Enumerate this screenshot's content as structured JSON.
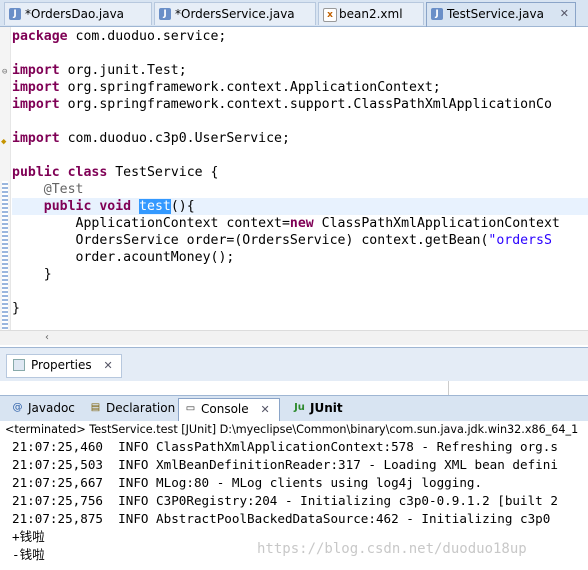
{
  "editor_tabs": [
    {
      "label": "*OrdersDao.java",
      "icon": "java-file-icon"
    },
    {
      "label": "*OrdersService.java",
      "icon": "java-file-icon"
    },
    {
      "label": "bean2.xml",
      "icon": "xml-file-icon"
    },
    {
      "label": "TestService.java",
      "icon": "java-file-icon",
      "active": true
    }
  ],
  "code": {
    "line1": {
      "kw": "package",
      "rest": " com.duoduo.service;"
    },
    "line3": {
      "kw": "import",
      "rest": " org.junit.Test;"
    },
    "line4": {
      "kw": "import",
      "rest": " org.springframework.context.ApplicationContext;"
    },
    "line5": {
      "kw": "import",
      "rest": " org.springframework.context.support.ClassPathXmlApplicationCo"
    },
    "line7": {
      "kw": "import",
      "rest": " com.duoduo.c3p0.UserService;"
    },
    "line9": {
      "kw1": "public",
      "kw2": "class",
      "rest": " TestService {"
    },
    "line10": {
      "ann": "@Test"
    },
    "line11": {
      "kw1": "public",
      "kw2": "void",
      "sel": "test",
      "rest": "(){"
    },
    "line12": {
      "pre": "ApplicationContext context=",
      "kw": "new",
      "rest": " ClassPathXmlApplicationContext"
    },
    "line13": {
      "pre": "OrdersService order=(OrdersService) context.getBean(",
      "str": "\"ordersS"
    },
    "line14": {
      "pre": "order.acountMoney();"
    },
    "line15": {
      "pre": "}"
    },
    "line17": {
      "pre": "}"
    }
  },
  "properties": {
    "label": "Properties"
  },
  "console_tabs": [
    {
      "label": "Javadoc",
      "icon": "javadoc-icon"
    },
    {
      "label": "Declaration",
      "icon": "declaration-icon"
    },
    {
      "label": "Console",
      "icon": "console-icon",
      "active": true
    },
    {
      "label": "JUnit",
      "icon": "junit-icon"
    }
  ],
  "console": {
    "status": "<terminated> TestService.test [JUnit] D:\\myeclipse\\Common\\binary\\com.sun.java.jdk.win32.x86_64_1",
    "lines": [
      "21:07:25,460  INFO ClassPathXmlApplicationContext:578 - Refreshing org.s",
      "21:07:25,503  INFO XmlBeanDefinitionReader:317 - Loading XML bean defini",
      "21:07:25,667  INFO MLog:80 - MLog clients using log4j logging.",
      "21:07:25,756  INFO C3P0Registry:204 - Initializing c3p0-0.9.1.2 [built 2",
      "21:07:25,875  INFO AbstractPoolBackedDataSource:462 - Initializing c3p0",
      "+钱啦",
      "-钱啦"
    ]
  },
  "watermark": "https://blog.csdn.net/duoduo18up",
  "colors": {
    "highlight": "#ffff00",
    "keyword": "#7f0055",
    "string": "#2a00ff",
    "selection": "#3399ff"
  }
}
